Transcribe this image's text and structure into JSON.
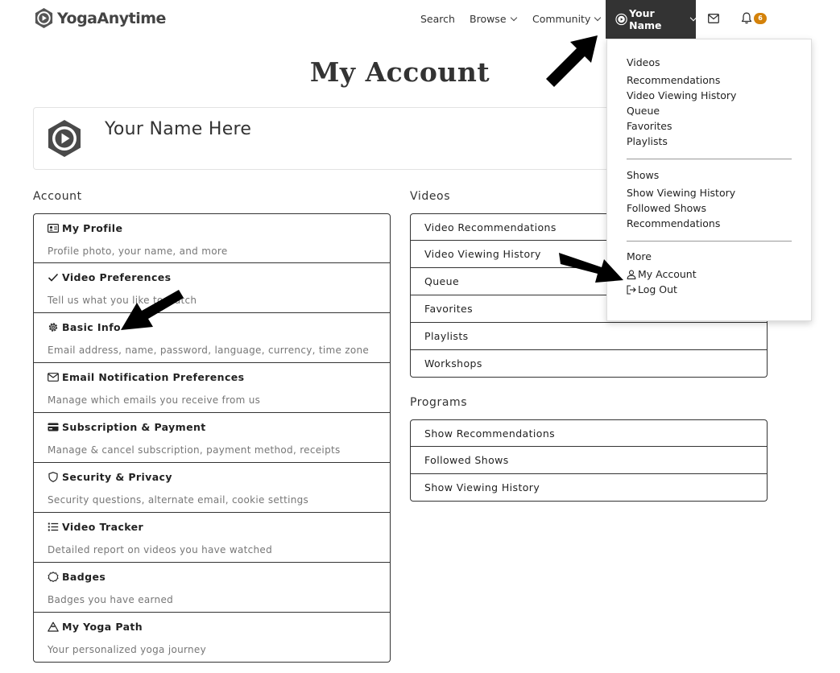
{
  "header": {
    "logo_text": "YogaAnytime",
    "nav": {
      "search": "Search",
      "browse": "Browse",
      "community": "Community",
      "user": "Your Name",
      "notification_count": "6"
    }
  },
  "page_title": "My Account",
  "profile": {
    "name": "Your Name Here"
  },
  "account": {
    "title": "Account",
    "items": [
      {
        "label": "My Profile",
        "desc": "Profile photo, your name, and more",
        "icon": "id-card-icon"
      },
      {
        "label": "Video Preferences",
        "desc": "Tell us what you like to watch",
        "icon": "check-icon"
      },
      {
        "label": "Basic Info",
        "desc": "Email address, name, password, language, currency, time zone",
        "icon": "gear-icon"
      },
      {
        "label": "Email Notification Preferences",
        "desc": "Manage which emails you receive from us",
        "icon": "envelope-icon"
      },
      {
        "label": "Subscription & Payment",
        "desc": "Manage & cancel subscription, payment method, receipts",
        "icon": "credit-card-icon"
      },
      {
        "label": "Security & Privacy",
        "desc": "Security questions, alternate email, cookie settings",
        "icon": "shield-icon"
      },
      {
        "label": "Video Tracker",
        "desc": "Detailed report on videos you have watched",
        "icon": "list-icon"
      },
      {
        "label": "Badges",
        "desc": "Badges you have earned",
        "icon": "badge-icon"
      },
      {
        "label": "My Yoga Path",
        "desc": "Your personalized yoga journey",
        "icon": "mountain-icon"
      }
    ]
  },
  "videos": {
    "title": "Videos",
    "items": [
      "Video Recommendations",
      "Video Viewing History",
      "Queue",
      "Favorites",
      "Playlists",
      "Workshops"
    ]
  },
  "programs": {
    "title": "Programs",
    "items": [
      "Show Recommendations",
      "Followed Shows",
      "Show Viewing History"
    ]
  },
  "dropdown": {
    "videos_title": "Videos",
    "videos_links": [
      "Recommendations",
      "Video Viewing History",
      "Queue",
      "Favorites",
      "Playlists"
    ],
    "shows_title": "Shows",
    "shows_links": [
      "Show Viewing History",
      "Followed Shows",
      "Recommendations"
    ],
    "more_title": "More",
    "my_account": "My Account",
    "log_out": "Log Out"
  },
  "colors": {
    "accent": "#d4820a",
    "nav_active_bg": "#333333",
    "text": "#333333",
    "muted": "#777777"
  }
}
